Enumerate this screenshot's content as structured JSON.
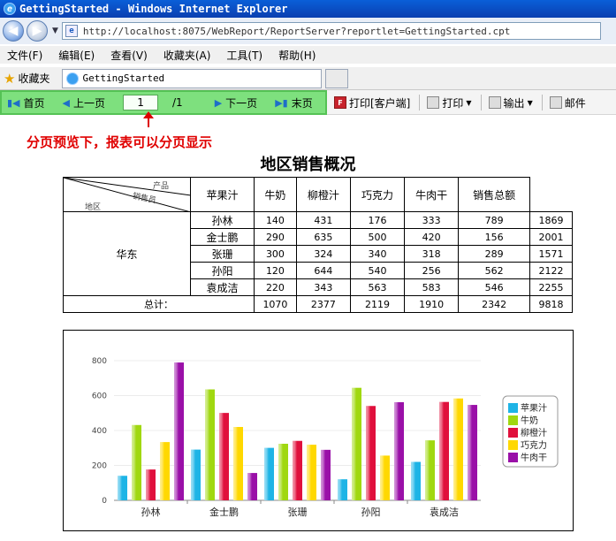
{
  "window": {
    "title": "GettingStarted - Windows Internet Explorer"
  },
  "address": {
    "url": "http://localhost:8075/WebReport/ReportServer?reportlet=GettingStarted.cpt"
  },
  "menu": {
    "items": [
      "文件(F)",
      "编辑(E)",
      "查看(V)",
      "收藏夹(A)",
      "工具(T)",
      "帮助(H)"
    ]
  },
  "favorites": {
    "label": "收藏夹",
    "tab_title": "GettingStarted"
  },
  "pager": {
    "first": "首页",
    "prev": "上一页",
    "page": "1",
    "total": "/1",
    "next": "下一页",
    "last": "末页"
  },
  "tools": {
    "print_client": "打印[客户端]",
    "print": "打印",
    "export": "输出",
    "mail": "邮件"
  },
  "annotation": "分页预览下，报表可以分页显示",
  "report": {
    "title": "地区销售概况",
    "corner_product": "产品",
    "corner_sales": "销售员",
    "corner_region": "地区",
    "columns": [
      "苹果汁",
      "牛奶",
      "柳橙汁",
      "巧克力",
      "牛肉干",
      "销售总额"
    ],
    "region": "华东",
    "rows": [
      {
        "name": "孙林",
        "values": [
          "140",
          "431",
          "176",
          "333",
          "789",
          "1869"
        ]
      },
      {
        "name": "金士鹏",
        "values": [
          "290",
          "635",
          "500",
          "420",
          "156",
          "2001"
        ]
      },
      {
        "name": "张珊",
        "values": [
          "300",
          "324",
          "340",
          "318",
          "289",
          "1571"
        ]
      },
      {
        "name": "孙阳",
        "values": [
          "120",
          "644",
          "540",
          "256",
          "562",
          "2122"
        ]
      },
      {
        "name": "袁成洁",
        "values": [
          "220",
          "343",
          "563",
          "583",
          "546",
          "2255"
        ]
      }
    ],
    "total_label": "总计：",
    "totals": [
      "1070",
      "2377",
      "2119",
      "1910",
      "2342",
      "9818"
    ]
  },
  "chart_data": {
    "type": "bar",
    "categories": [
      "孙林",
      "金士鹏",
      "张珊",
      "孙阳",
      "袁成洁"
    ],
    "series": [
      {
        "name": "苹果汁",
        "color": "#1eb4e6",
        "values": [
          140,
          290,
          300,
          120,
          220
        ]
      },
      {
        "name": "牛奶",
        "color": "#a0d810",
        "values": [
          431,
          635,
          324,
          644,
          343
        ]
      },
      {
        "name": "柳橙汁",
        "color": "#e0103c",
        "values": [
          176,
          500,
          340,
          540,
          563
        ]
      },
      {
        "name": "巧克力",
        "color": "#ffd800",
        "values": [
          333,
          420,
          318,
          256,
          583
        ]
      },
      {
        "name": "牛肉干",
        "color": "#9a10a8",
        "values": [
          789,
          156,
          289,
          562,
          546
        ]
      }
    ],
    "yticks": [
      0,
      200,
      400,
      600,
      800
    ],
    "ylim": [
      0,
      800
    ],
    "grid": true,
    "legend": "right"
  }
}
